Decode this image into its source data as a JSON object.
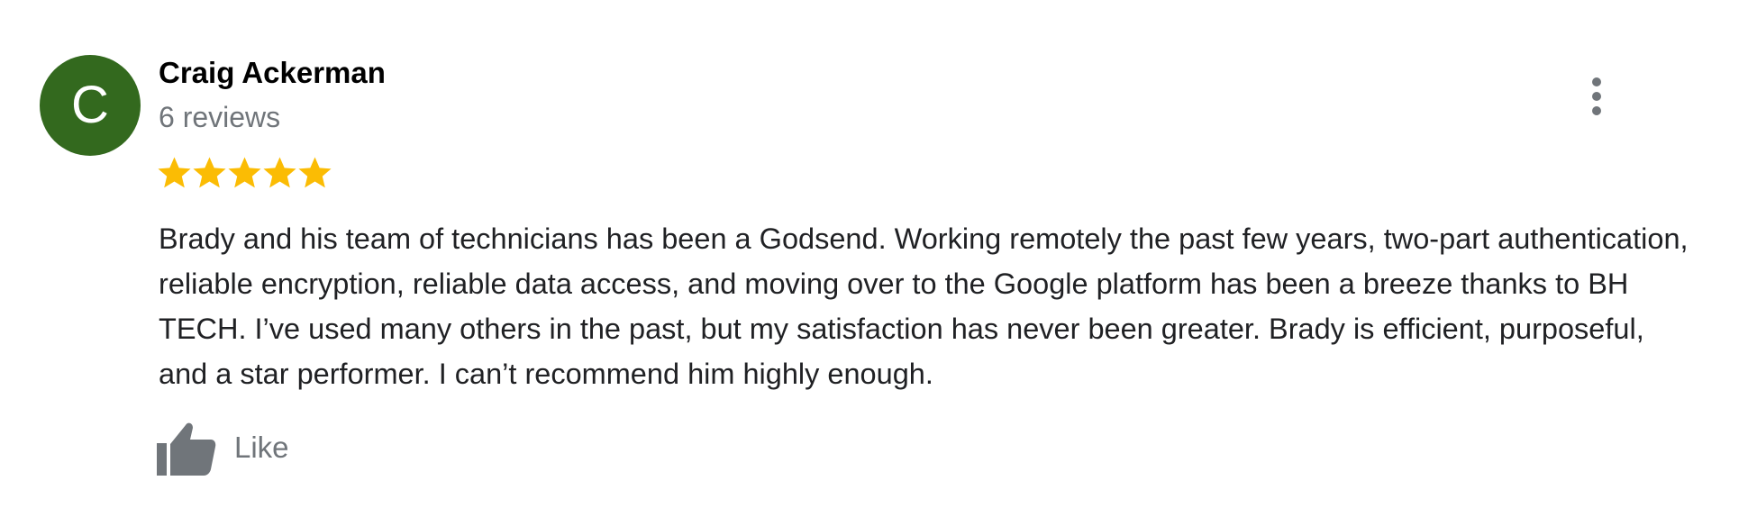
{
  "review": {
    "avatar_letter": "C",
    "avatar_color": "#33691e",
    "author_name": "Craig Ackerman",
    "review_count": "6 reviews",
    "rating": 5,
    "rating_max": 5,
    "star_color": "#fbbc04",
    "text": "Brady and his team of technicians has been a Godsend. Working remotely the past few years, two-part authentication, reliable encryption, reliable data access, and moving over to the Google platform has been a breeze thanks to BH TECH. I’ve used many others in the past, but my satisfaction has never been greater. Brady is efficient, purposeful, and a star performer. I can’t recommend him highly enough.",
    "like_label": "Like",
    "menu_icon": "more-vert-icon",
    "like_icon": "thumb-up-icon",
    "star_icon": "star-icon"
  }
}
